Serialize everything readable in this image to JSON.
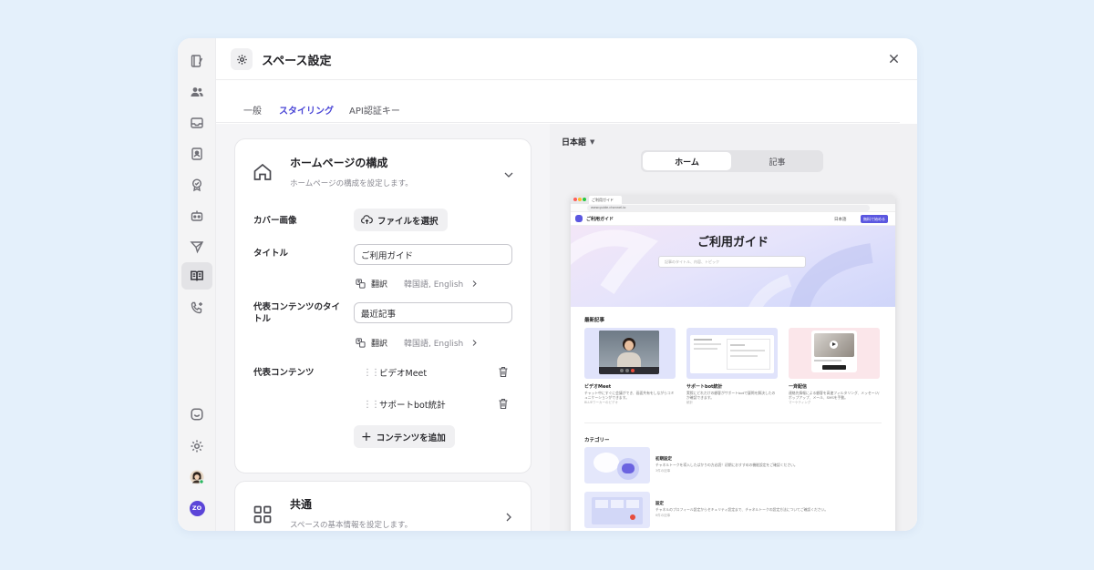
{
  "header": {
    "title": "スペース設定"
  },
  "tabs": [
    {
      "label": "一般"
    },
    {
      "label": "スタイリング"
    },
    {
      "label": "API認証キー"
    }
  ],
  "sidebar": {
    "items": [
      {
        "icon": "notebook-icon"
      },
      {
        "icon": "users-icon"
      },
      {
        "icon": "inbox-icon"
      },
      {
        "icon": "contact-icon"
      },
      {
        "icon": "badge-icon"
      },
      {
        "icon": "bot-icon"
      },
      {
        "icon": "send-icon"
      },
      {
        "icon": "book-open-icon"
      },
      {
        "icon": "phone-icon"
      }
    ],
    "bottom": [
      {
        "icon": "chat-icon"
      },
      {
        "icon": "settings-icon"
      },
      {
        "icon": "avatar"
      },
      {
        "icon": "workspace-avatar",
        "label": "ZO"
      }
    ]
  },
  "homepage_card": {
    "title": "ホームページの構成",
    "subtitle": "ホームページの構成を設定します。",
    "cover_label": "カバー画像",
    "file_button": "ファイルを選択",
    "title_label": "タイトル",
    "title_value": "ご利用ガイド",
    "translate_label": "翻訳",
    "translate_langs": "韓国語, English",
    "featured_title_label": "代表コンテンツのタイトル",
    "featured_title_value": "最近記事",
    "featured_label": "代表コンテンツ",
    "featured_items": [
      "ビデオMeet",
      "サポートbot統計"
    ],
    "add_button": "コンテンツを追加"
  },
  "common_card": {
    "title": "共通",
    "subtitle": "スペースの基本情報を設定します。"
  },
  "preview": {
    "language": "日本語",
    "segments": [
      "ホーム",
      "記事"
    ],
    "browser_tab": "ご利用ガイド",
    "browser_url": "www.guide.channel.io",
    "site_name": "ご利用ガイド",
    "site_lang": "日本語",
    "site_button": "無料で始める",
    "hero_title": "ご利用ガイド",
    "hero_search": "記事のタイトル、内容、トピック",
    "recent_label": "最新記事",
    "articles": [
      {
        "title": "ビデオMeet",
        "desc": "チャット中にすぐに会議ができ、画面共有をしながらコミュニケーションができます。",
        "meta": "BLUEワーカーのビデオ"
      },
      {
        "title": "サポートbot統計",
        "desc": "実際にどれだけの顧客がサポートbotで疑問を解決したのか確認できます。",
        "meta": "統計"
      },
      {
        "title": "一斉配信",
        "desc": "連絡先情報による顧客を高速フィルタリング、メッセージ/ポップアップ、メール、SMSを手動。",
        "meta": "マーケティング"
      }
    ],
    "category_label": "カテゴリー",
    "categories": [
      {
        "title": "初期設定",
        "desc": "チャネルトークを導入したばかりの方必読！初期におすすめの機能設定をご確認ください。",
        "meta": "3件の記事"
      },
      {
        "title": "設定",
        "desc": "チャネルのプロフィール設定からセキュリティ設定まで、チャネルトークの設定方法についてご確認ください。",
        "meta": "6件の記事"
      }
    ]
  },
  "colors": {
    "accent": "#4a46d6",
    "background": "#e4f0fb"
  }
}
